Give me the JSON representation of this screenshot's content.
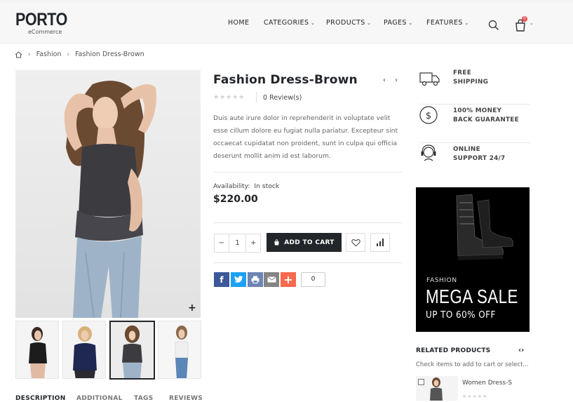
{
  "header": {
    "logo": "PORTO",
    "logo_sub": "eCommerce",
    "nav": [
      {
        "label": "HOME",
        "has_caret": false
      },
      {
        "label": "CATEGORIES",
        "has_caret": true
      },
      {
        "label": "PRODUCTS",
        "has_caret": true
      },
      {
        "label": "PAGES",
        "has_caret": true
      },
      {
        "label": "FEATURES",
        "has_caret": true
      }
    ],
    "cart_count": "0",
    "icons": [
      "search-icon",
      "cart-icon"
    ]
  },
  "breadcrumb": {
    "home_icon": "home-icon",
    "items": [
      "Fashion",
      "Fashion Dress-Brown"
    ]
  },
  "product": {
    "title": "Fashion Dress-Brown",
    "reviews": "0 Review(s)",
    "description": "Duis aute irure dolor in reprehenderit in voluptate velit esse cillum dolore eu fugiat nulla pariatur. Excepteur sint occaecat cupidatat non proident, sunt in culpa qui officia deserunt mollit anim id est laborum.",
    "availability_label": "Availability:",
    "availability_value": "In stock",
    "price": "$220.00",
    "quantity": "1",
    "add_to_cart": "ADD TO CART",
    "share_count": "0",
    "rating_stars": 0,
    "active_thumbnail": 3
  },
  "tabs": [
    "DESCRIPTION",
    "ADDITIONAL",
    "TAGS",
    "REVIEWS"
  ],
  "sidebar": {
    "features": [
      {
        "icon": "truck-icon",
        "line1": "FREE",
        "line2": "SHIPPING"
      },
      {
        "icon": "dollar-icon",
        "line1": "100% MONEY",
        "line2": "BACK GUARANTEE"
      },
      {
        "icon": "support-icon",
        "line1": "ONLINE",
        "line2": "SUPPORT 24/7"
      }
    ],
    "banner": {
      "small": "FASHION",
      "big": "MEGA SALE",
      "sub": "UP TO 60% OFF"
    },
    "related_title": "RELATED PRODUCTS",
    "related_hint": "Check items to add to cart or select...",
    "related_items": [
      {
        "name": "Women Dress-S"
      }
    ]
  }
}
